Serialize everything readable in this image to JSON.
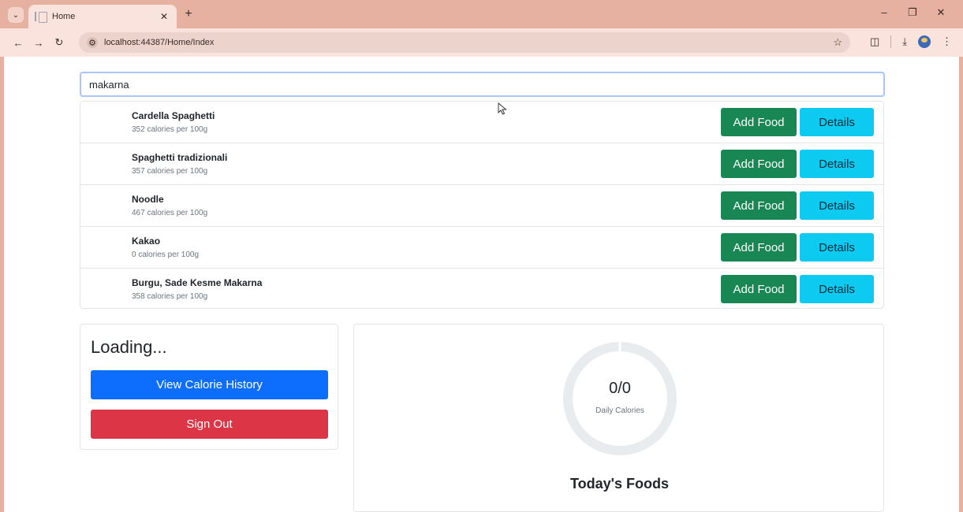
{
  "browser": {
    "tab_title": "Home",
    "url": "localhost:44387/Home/Index",
    "icons": {
      "tab_menu": "chevron-down-icon",
      "back": "arrow-left-icon",
      "forward": "arrow-right-icon",
      "reload": "reload-icon",
      "site_info": "site-settings-icon",
      "bookmark": "star-icon",
      "extensions": "puzzle-icon",
      "downloads": "download-icon",
      "menu": "more-vertical-icon"
    }
  },
  "search": {
    "value": "makarna"
  },
  "foods": [
    {
      "name": "Cardella Spaghetti",
      "calories": "352 calories per 100g"
    },
    {
      "name": "Spaghetti tradizionali",
      "calories": "357 calories per 100g"
    },
    {
      "name": "Noodle",
      "calories": "467 calories per 100g"
    },
    {
      "name": "Kakao",
      "calories": "0 calories per 100g"
    },
    {
      "name": "Burgu, Sade Kesme Makarna",
      "calories": "358 calories per 100g"
    }
  ],
  "food_actions": {
    "add_label": "Add Food",
    "details_label": "Details"
  },
  "user_panel": {
    "heading": "Loading...",
    "history_label": "View Calorie History",
    "signout_label": "Sign Out"
  },
  "calories": {
    "value": "0/0",
    "label": "Daily Calories",
    "progress": 0,
    "foods_heading": "Today's Foods"
  },
  "colors": {
    "chrome": "#e6b1a0",
    "add_button": "#198754",
    "details_button": "#0dcaf0",
    "history_button": "#0d6efd",
    "signout_button": "#dc3545",
    "ring_track": "#e9ecef"
  }
}
